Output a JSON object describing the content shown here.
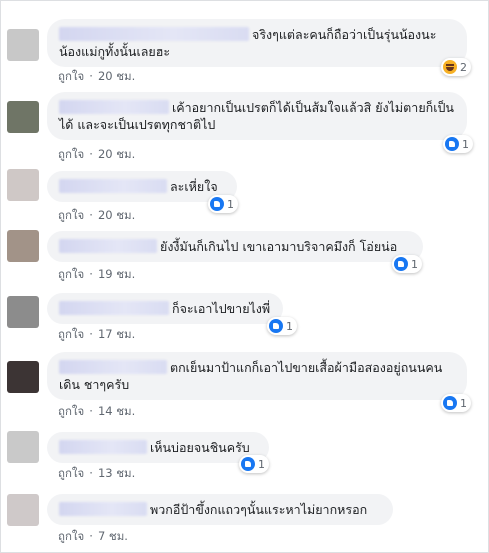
{
  "ui": {
    "like_label": "ถูกใจ",
    "separator": "·"
  },
  "comments": [
    {
      "text": "จริงๆแต่ละคนก็ถือว่าเป็นรุ่นน้องนะ น้องแม่กูทั้งนั้นเลยฮะ",
      "time": "20 ชม.",
      "reaction": "haha-icon",
      "count": "2"
    },
    {
      "text": "เค้าอยากเป็นเปรตก็ได้เป็นส้มใจแล้วสิ ยังไม่ตายก็เป็นได้ และจะเป็นเปรตทุกชาติไป",
      "time": "20 ชม.",
      "reaction": "like-icon",
      "count": "1"
    },
    {
      "text": "ละเหี่ยใจ",
      "time": "20 ชม.",
      "reaction": "like-icon",
      "count": "1"
    },
    {
      "text": "ยังงี้มันก็เกินไป เขาเอามาบริจาคมึงก็ โอ่ยน่อ",
      "time": "19 ชม.",
      "reaction": "like-icon",
      "count": "1"
    },
    {
      "text": "ก็จะเอาไปขายไงพี่",
      "time": "17 ชม.",
      "reaction": "like-icon",
      "count": "1"
    },
    {
      "text": "ตกเย็นมาป้าแกก็เอาไปขายเสื้อผ้ามือสองอยู่ถนนคนเดิน ชาๆครับ",
      "time": "14 ชม.",
      "reaction": "like-icon",
      "count": "1"
    },
    {
      "text": "เห็นบ่อยจนชินครับ",
      "time": "13 ชม.",
      "reaction": "like-icon",
      "count": "1"
    },
    {
      "text": "พวกอีป้าขึ้งกแถวๆนั้นแระหาไม่ยากหรอก",
      "time": "7 ชม.",
      "reaction": "",
      "count": ""
    }
  ]
}
